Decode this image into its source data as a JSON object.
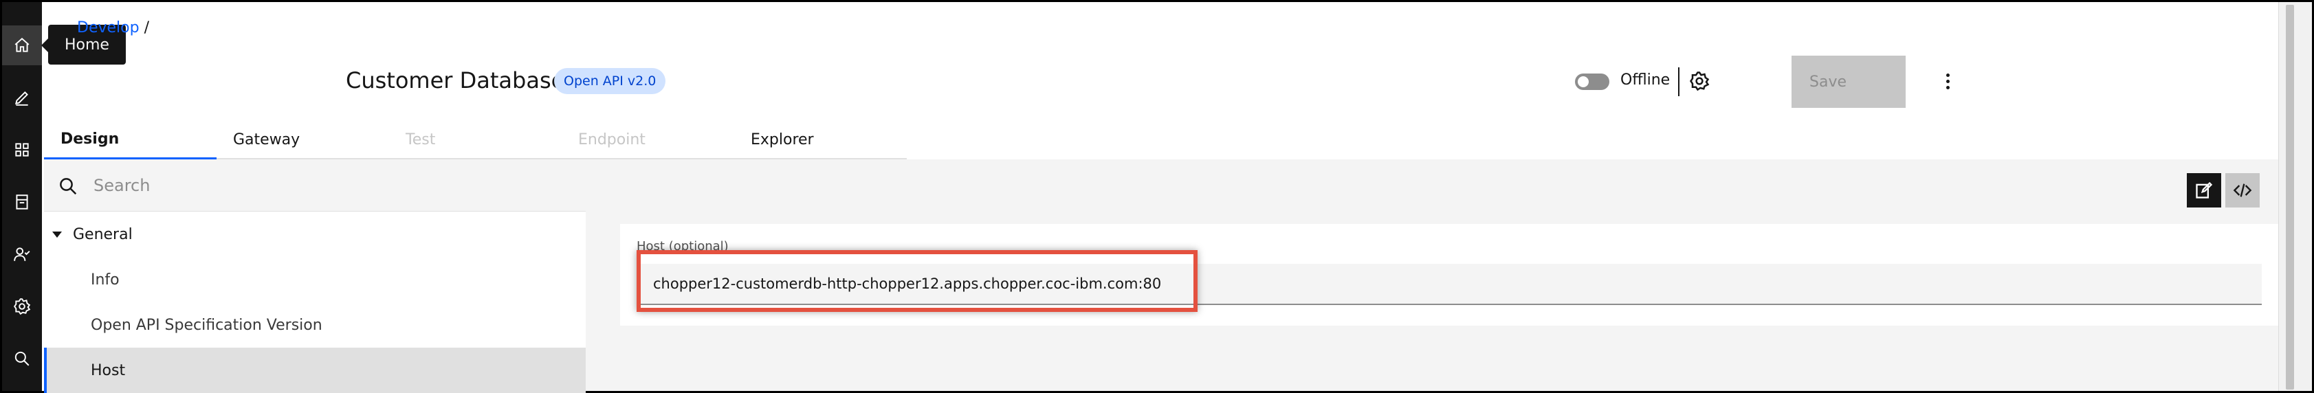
{
  "rail": {
    "items": [
      {
        "icon": "home-icon",
        "label": "Home"
      },
      {
        "icon": "edit-icon",
        "label": "Edit"
      },
      {
        "icon": "apps-icon",
        "label": "Apps"
      },
      {
        "icon": "catalog-icon",
        "label": "Catalog"
      },
      {
        "icon": "users-icon",
        "label": "Users"
      },
      {
        "icon": "settings-icon",
        "label": "Settings"
      },
      {
        "icon": "search-icon",
        "label": "Search"
      }
    ]
  },
  "tooltip": {
    "text": "Home"
  },
  "breadcrumb": {
    "link": "Develop",
    "separator": "/"
  },
  "header": {
    "title": "Customer Database",
    "api_tag": "Open API v2.0",
    "status_label": "Offline",
    "save_label": "Save"
  },
  "tabs": [
    {
      "label": "Design",
      "state": "selected"
    },
    {
      "label": "Gateway",
      "state": "normal"
    },
    {
      "label": "Test",
      "state": "disabled"
    },
    {
      "label": "Endpoint",
      "state": "disabled"
    },
    {
      "label": "Explorer",
      "state": "normal"
    }
  ],
  "sidebar": {
    "search_placeholder": "Search",
    "group_label": "General",
    "items": [
      {
        "label": "Info"
      },
      {
        "label": "Open API Specification Version"
      },
      {
        "label": "Host"
      }
    ]
  },
  "form": {
    "host_label": "Host (optional)",
    "host_value": "chopper12-customerdb-http-chopper12.apps.chopper.coc-ibm.com:80"
  },
  "colors": {
    "accent": "#0f62fe",
    "rail_bg": "#161616",
    "tag_bg": "#d0e2ff",
    "highlight": "#e4513f"
  }
}
